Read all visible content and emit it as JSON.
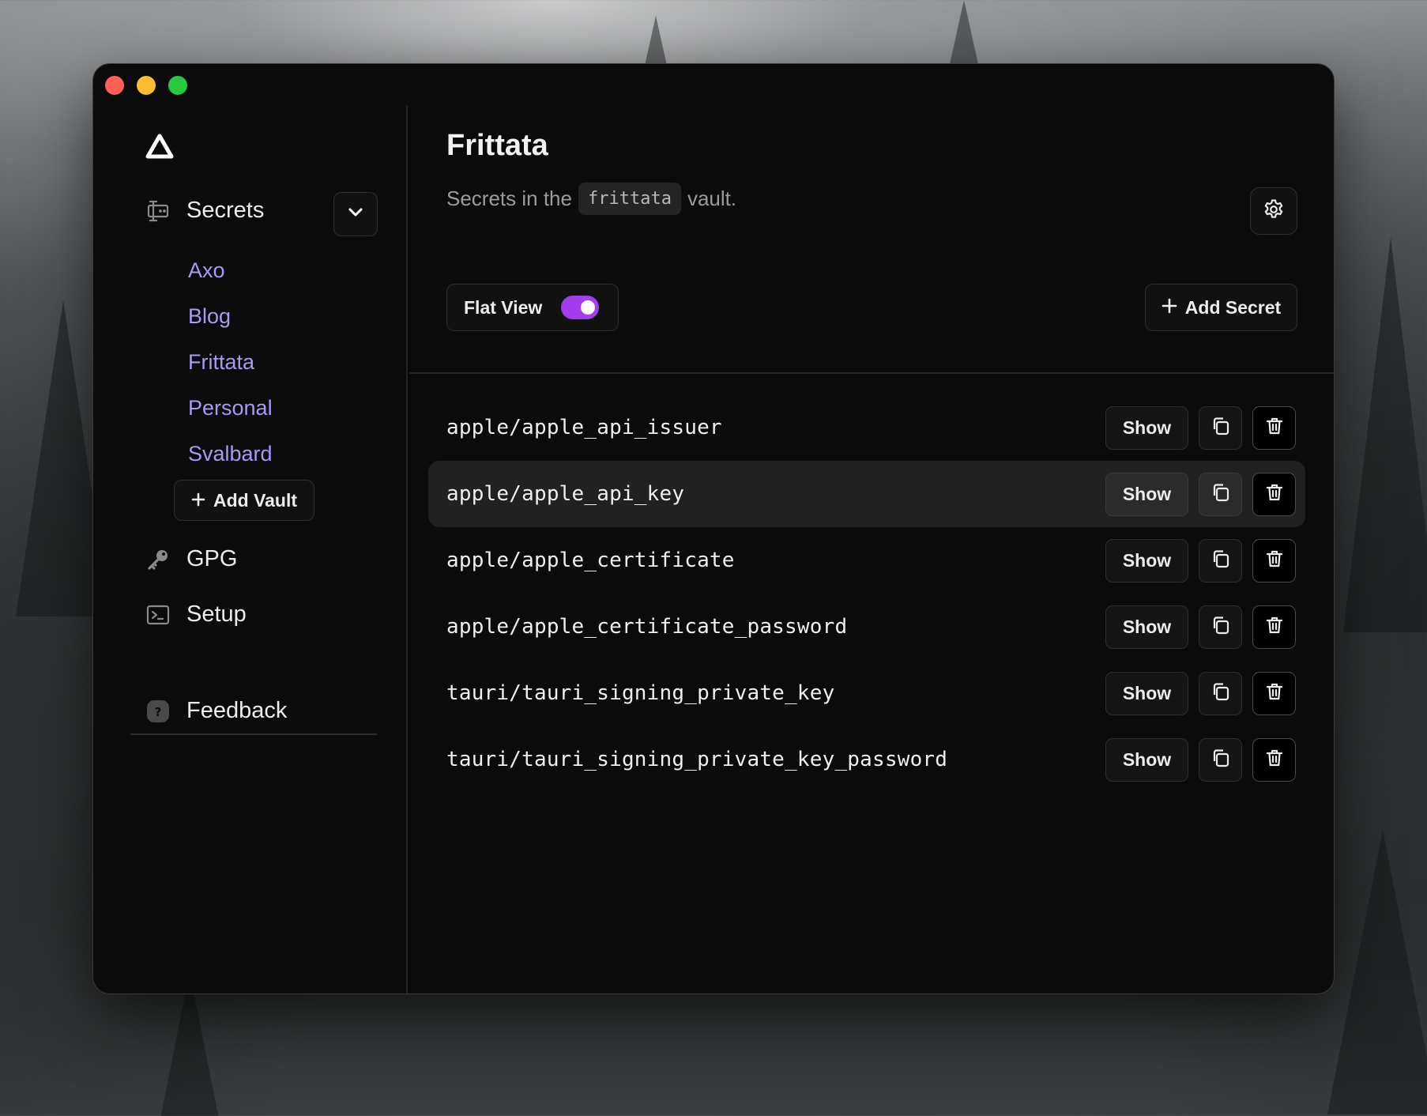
{
  "app": {
    "logo_icon": "triangle-logo-icon"
  },
  "sidebar": {
    "secrets": {
      "label": "Secrets",
      "icon": "secrets-icon",
      "toggle_icon": "chevron-down-icon"
    },
    "vaults": [
      {
        "label": "Axo"
      },
      {
        "label": "Blog"
      },
      {
        "label": "Frittata"
      },
      {
        "label": "Personal"
      },
      {
        "label": "Svalbard"
      }
    ],
    "add_vault_label": "Add Vault",
    "gpg": {
      "label": "GPG",
      "icon": "key-icon"
    },
    "setup": {
      "label": "Setup",
      "icon": "terminal-icon"
    },
    "feedback": {
      "label": "Feedback",
      "icon": "question-icon"
    }
  },
  "main": {
    "title": "Frittata",
    "subtitle_prefix": "Secrets in the",
    "subtitle_code": "frittata",
    "subtitle_suffix": "vault.",
    "flat_view_label": "Flat View",
    "flat_view_on": true,
    "add_secret_label": "Add Secret",
    "settings_icon": "gear-icon"
  },
  "secrets": [
    {
      "name": "apple/apple_api_issuer",
      "show_label": "Show"
    },
    {
      "name": "apple/apple_api_key",
      "show_label": "Show"
    },
    {
      "name": "apple/apple_certificate",
      "show_label": "Show"
    },
    {
      "name": "apple/apple_certificate_password",
      "show_label": "Show"
    },
    {
      "name": "tauri/tauri_signing_private_key",
      "show_label": "Show"
    },
    {
      "name": "tauri/tauri_signing_private_key_password",
      "show_label": "Show"
    }
  ],
  "colors": {
    "accent": "#a43df0",
    "vault_link": "#a59bf5",
    "window_bg": "#0b0b0b"
  }
}
